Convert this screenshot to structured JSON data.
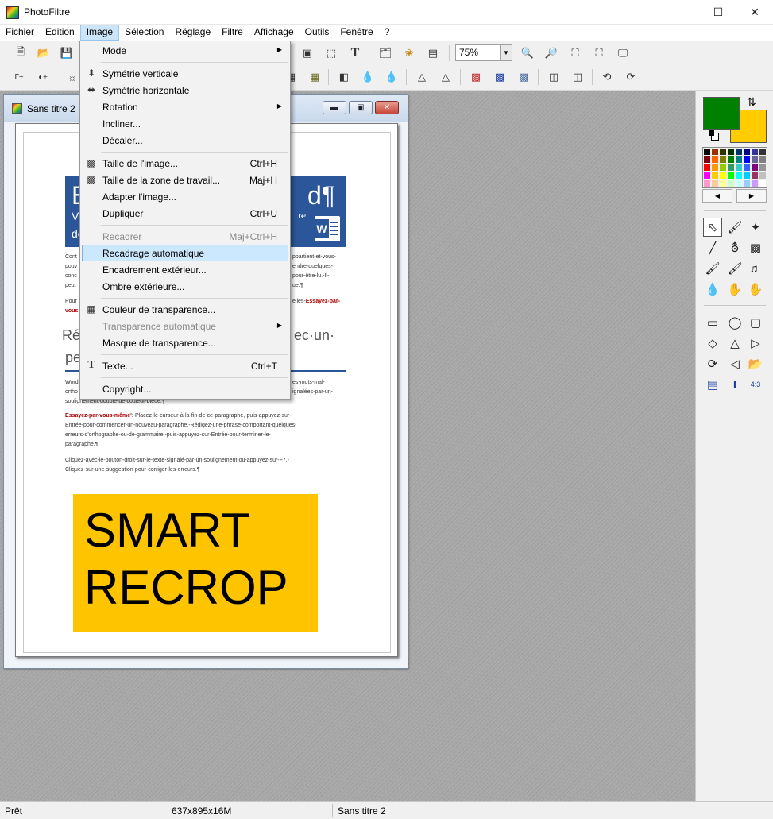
{
  "window": {
    "title": "PhotoFiltre"
  },
  "menubar": [
    "Fichier",
    "Edition",
    "Image",
    "Sélection",
    "Réglage",
    "Filtre",
    "Affichage",
    "Outils",
    "Fenêtre",
    "?"
  ],
  "toolbar": {
    "zoom_value": "75%"
  },
  "doc_window": {
    "title": "Sans titre 2",
    "banner_big_left": "B",
    "banner_big_right": "d¶",
    "banner_line1": "Vo",
    "banner_line2": "de",
    "banner_small": "r↵",
    "body_lines_left": [
      "Cont",
      "pouv",
      "conc",
      "peut"
    ],
    "body_lines_right": [
      "ppartient-et-vous-",
      "endre-quelques-",
      "pour-être-lu.-Il-",
      "ue.¶"
    ],
    "pour_left": "Pour",
    "pour_left2": "vous",
    "pour_right": "ellés-",
    "pour_right_red": "Essayez-par-",
    "heading_left1": "Ré",
    "heading_left2": "pe",
    "heading_right": "ec·un·",
    "words_left": [
      "Word",
      "ortho"
    ],
    "words_right": [
      "es-mots-mal-",
      "ignalées-par-un-"
    ],
    "words_line3": "soulignement-double-de-couleur-bleue.¶",
    "essayez_red": "Essayez-par-vous-même'",
    "essayez_line1": ":-Placez-le-curseur-à-la-fin-de-ce-paragraphe,-puis-appuyez-sur-",
    "essayez_line2": "Entrée-pour-commencer-un-nouveau-paragraphe.-Rédigez-une-phrase-comportant-quelques-",
    "essayez_line3": "erreurs-d'orthographe-ou-de-grammaire,-puis-appuyez-sur-Entrée-pour-terminer-le-",
    "essayez_line4": "paragraphe.¶",
    "cliquez_line1": "Cliquez-avec-le-bouton-droit-sur-le-texte-signalé-par-un-soulignement-ou-appuyez-sur-F7.-",
    "cliquez_line2": "Cliquez-sur-une-suggestion-pour-corriger-les-erreurs.¶",
    "smart_line1": "SMART",
    "smart_line2": "RECROP"
  },
  "image_menu": {
    "items": [
      {
        "label": "Mode",
        "submenu": true,
        "icon": ""
      },
      {
        "label": "Symétrie verticale",
        "icon": "flip-vertical-icon"
      },
      {
        "label": "Symétrie horizontale",
        "icon": "flip-horizontal-icon"
      },
      {
        "label": "Rotation",
        "submenu": true
      },
      {
        "label": "Incliner..."
      },
      {
        "label": "Décaler..."
      },
      {
        "label": "Taille de l'image...",
        "shortcut": "Ctrl+H",
        "icon": "image-size-icon"
      },
      {
        "label": "Taille de la zone de travail...",
        "shortcut": "Maj+H",
        "icon": "canvas-size-icon"
      },
      {
        "label": "Adapter l'image..."
      },
      {
        "label": "Dupliquer",
        "shortcut": "Ctrl+U"
      },
      {
        "label": "Recadrer",
        "shortcut": "Maj+Ctrl+H",
        "disabled": true
      },
      {
        "label": "Recadrage automatique",
        "highlighted": true
      },
      {
        "label": "Encadrement extérieur..."
      },
      {
        "label": "Ombre extérieure..."
      },
      {
        "label": "Couleur de transparence...",
        "icon": "transparency-color-icon"
      },
      {
        "label": "Transparence automatique",
        "submenu": true,
        "disabled": true
      },
      {
        "label": "Masque de transparence..."
      },
      {
        "label": "Texte...",
        "shortcut": "Ctrl+T",
        "icon": "text-icon"
      },
      {
        "label": "Copyright..."
      }
    ]
  },
  "colors": {
    "foreground": "#008000",
    "background": "#ffcc00",
    "accent": "#2b579a",
    "smart_box": "#ffc400"
  },
  "statusbar": {
    "state": "Prêt",
    "image_info": "637x895x16M",
    "doc_name": "Sans titre 2"
  }
}
